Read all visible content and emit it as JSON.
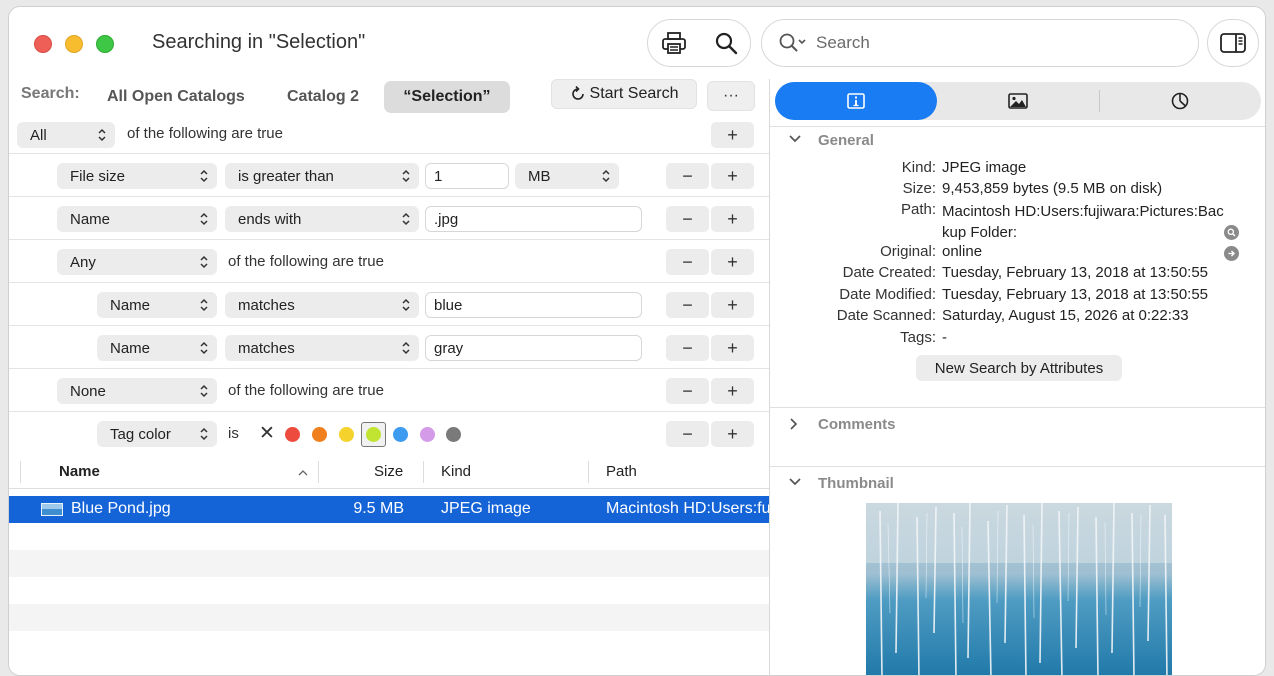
{
  "window": {
    "title": "Searching in \"Selection\"",
    "search_placeholder": "Search"
  },
  "query": {
    "label": "Search:",
    "scopes": [
      {
        "label": "All Open Catalogs",
        "active": false
      },
      {
        "label": "Catalog 2",
        "active": false
      },
      {
        "label": "“Selection”",
        "active": true
      }
    ],
    "start_label": "Start Search",
    "more_label": "···",
    "root": {
      "match": "All",
      "text": "of the following are true"
    },
    "rows": [
      {
        "field": "File size",
        "operator": "is greater than",
        "value": "1",
        "unit": "MB"
      },
      {
        "field": "Name",
        "operator": "ends with",
        "value": ".jpg"
      },
      {
        "match": "Any",
        "text": "of the following are true"
      },
      {
        "field": "Name",
        "operator": "matches",
        "value": "blue"
      },
      {
        "field": "Name",
        "operator": "matches",
        "value": "gray"
      },
      {
        "match": "None",
        "text": "of the following are true"
      },
      {
        "field": "Tag color",
        "operator": "is"
      }
    ],
    "tag_colors": [
      "#ee4b3f",
      "#f07f1e",
      "#f6d32c",
      "#c1e433",
      "#3d9bf0",
      "#d49be8",
      "#7a7a7a"
    ],
    "tag_none_glyph": "✕"
  },
  "results": {
    "columns": [
      "Name",
      "Size",
      "Kind",
      "Path"
    ],
    "rows": [
      {
        "name": "Blue Pond.jpg",
        "size": "9.5 MB",
        "kind": "JPEG image",
        "path": "Macintosh HD:Users:fujiwara:Pictures:Backup Folder:"
      }
    ]
  },
  "info": {
    "general_label": "General",
    "fields": [
      {
        "key": "Kind:",
        "value": "JPEG image"
      },
      {
        "key": "Size:",
        "value": "9,453,859 bytes (9.5 MB on disk)"
      },
      {
        "key": "Path:",
        "value": "Macintosh HD:Users:fujiwara:Pictures:Backup Folder:"
      },
      {
        "key": "Original:",
        "value": "online"
      },
      {
        "key": "Date Created:",
        "value": "Tuesday, February 13, 2018 at 13:50:55"
      },
      {
        "key": "Date Modified:",
        "value": "Tuesday, February 13, 2018 at 13:50:55"
      },
      {
        "key": "Date Scanned:",
        "value": "Saturday, August 15, 2026 at 0:22:33"
      },
      {
        "key": "Tags:",
        "value": "-"
      }
    ],
    "new_search_label": "New Search by Attributes",
    "comments_label": "Comments",
    "thumbnail_label": "Thumbnail"
  },
  "colors": {
    "accent": "#1a7cf3",
    "selection": "#1464d8"
  }
}
